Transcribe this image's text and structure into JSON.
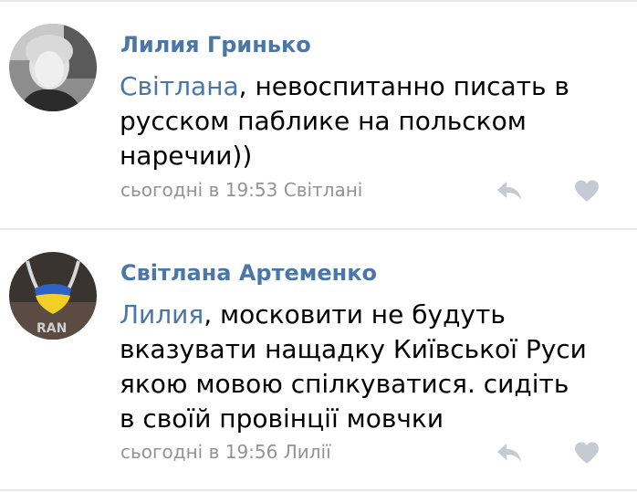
{
  "comments": [
    {
      "author": "Лилия Гринько",
      "mention": "Світлана",
      "text_lines": [
        ", невоспитанно писать в",
        "русском паблике на польском",
        "наречии))"
      ],
      "time": "сьогодні в 19:53",
      "reply_to": "Світлані",
      "avatar_icon": "user-photo",
      "reply_icon": "reply-arrow-icon",
      "like_icon": "heart-icon"
    },
    {
      "author": "Світлана Артеменко",
      "mention": "Лилия",
      "text_lines": [
        ", московити не будуть",
        "вказувати нащадку Київської Руси",
        "якою мовою спілкуватися.  сидіть",
        "в своїй провінції мовчки"
      ],
      "time": "сьогодні в 19:56",
      "reply_to": "Лилії",
      "avatar_icon": "user-photo",
      "reply_icon": "reply-arrow-icon",
      "like_icon": "heart-icon"
    }
  ],
  "colors": {
    "link": "#4a76a8",
    "meta": "#939393",
    "icon": "#c5cbd3",
    "divider": "#e7e8ec"
  }
}
